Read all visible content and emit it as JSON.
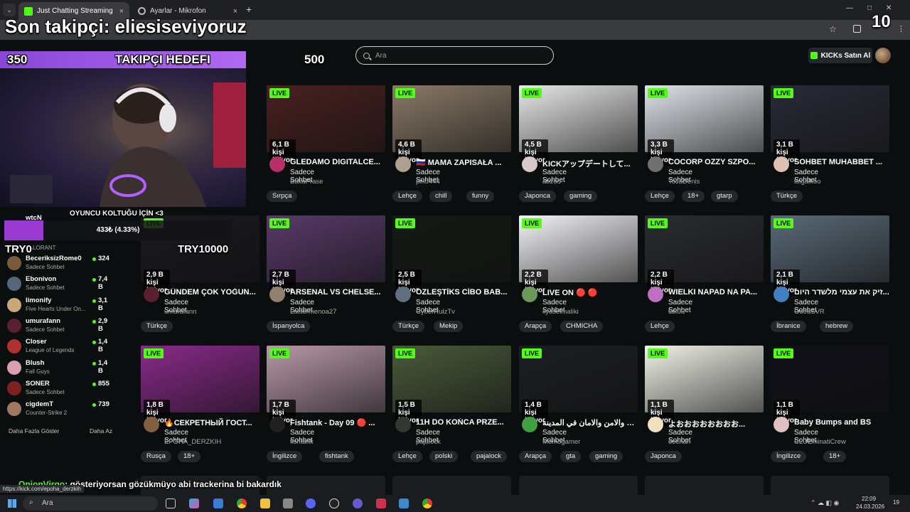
{
  "browser": {
    "tabs": [
      {
        "label": "Just Chatting Streaming - Live S",
        "active": true
      },
      {
        "label": "Ayarlar - Mikrofon",
        "active": false
      }
    ],
    "new_tab": "+",
    "close": "×"
  },
  "site": {
    "search_placeholder": "Ara",
    "kicks_button": "KICKs Satın Al",
    "accent": "#53fc18"
  },
  "overlay": {
    "last_follower": "Son takipçi: eliesiseviyoruz",
    "counter": "10",
    "goal_start": "350",
    "goal_label": "TAKIPÇI HEDEFI",
    "goal_end": "500",
    "chair_goal": "OYUNCU KOLTUĞU İÇİN <3",
    "chair_progress": "433₺ (4.33%)",
    "chair_fraction": 0.0433,
    "try0": "TRY0",
    "try10000": "TRY10000",
    "chat_user": "OnionVirgo",
    "chat_message": ": gösteriyorsan gözükmüyo abi trackerina bi bakardık",
    "peek_user": "wtcN",
    "peek_cat": "VALORANT"
  },
  "sidebar": {
    "channels": [
      {
        "name": "BeceriksizRome0",
        "category": "Sadece Sohbet",
        "count": "324",
        "color": "#7a5a3a"
      },
      {
        "name": "Ebonivon",
        "category": "Sadece Sohbet",
        "count": "7,4 B",
        "color": "#556677"
      },
      {
        "name": "limonify",
        "category": "Five Hearts Under On...",
        "count": "3,1 B",
        "color": "#c8a878"
      },
      {
        "name": "umurafann",
        "category": "Sadece Sohbet",
        "count": "2,9 B",
        "color": "#5a2030"
      },
      {
        "name": "Closer",
        "category": "League of Legends",
        "count": "1,4 B",
        "color": "#b03030"
      },
      {
        "name": "Blush",
        "category": "Fall Guys",
        "count": "1,4 B",
        "color": "#d8a0b0"
      },
      {
        "name": "SONER",
        "category": "Sadece Sohbet",
        "count": "855",
        "color": "#802020"
      },
      {
        "name": "cigdemT",
        "category": "Counter-Strike 2",
        "count": "739",
        "color": "#a07860"
      }
    ],
    "more": "Daha Fazla Göster",
    "less": "Daha Az"
  },
  "streams": [
    {
      "title": "GLEDAMO DIGITALCE...",
      "category": "Sadece Sohbet",
      "user": "BakaPrase",
      "viewers": "6,1 B kişi izliyor",
      "tags": [
        "Sırpça"
      ],
      "thumb": "#4a2020",
      "avatar": "#b8306a"
    },
    {
      "title": "🇷🇺 MAMA ZAPISAŁA ...",
      "category": "Sadece Sohbet",
      "user": "pirlo444",
      "viewers": "4,6 B kişi izliyor",
      "tags": [
        "Lehçe",
        "chill",
        "funny"
      ],
      "thumb": "#8a7a68",
      "avatar": "#b0a090"
    },
    {
      "title": "KICKアップデートして...",
      "category": "Sadece Sohbet",
      "user": "abzou",
      "viewers": "4,5 B kişi izliyor",
      "tags": [
        "Japonca",
        "gaming"
      ],
      "thumb": "#e8e8e8",
      "avatar": "#d8c8c8"
    },
    {
      "title": "COCORP OZZY SZPO...",
      "category": "Sadece Sohbet",
      "user": "ToJaDenis",
      "viewers": "3,3 B kişi izliyor",
      "tags": [
        "Lehçe",
        "18+",
        "gtarp"
      ],
      "thumb": "#dfe4ea",
      "avatar": "#707070"
    },
    {
      "title": "SOHBET MUHABBET ...",
      "category": "Sadece Sohbet",
      "user": "tsigalkoo",
      "viewers": "3,1 B kişi izliyor",
      "tags": [
        "Türkçe"
      ],
      "thumb": "#2a2a38",
      "avatar": "#e0c0b0"
    },
    {
      "title": "GÜNDEM ÇOK YOĞUN...",
      "category": "Sadece Sohbet",
      "user": "umurafann",
      "viewers": "2,9 B kişi izliyor",
      "tags": [
        "Türkçe"
      ],
      "thumb": "#1a1a20",
      "avatar": "#5a2030"
    },
    {
      "title": "ARSENAL VS CHELSE...",
      "category": "Sadece Sohbet",
      "user": "Luisormenoa27",
      "viewers": "2,7 B kişi izliyor",
      "tags": [
        "İspanyolca"
      ],
      "thumb": "#5a3a6a",
      "avatar": "#908070"
    },
    {
      "title": "ÖZLEŞTİKS CİBO BAB...",
      "category": "Sadece Sohbet",
      "user": "CyberRulzTv",
      "viewers": "2,5 B kişi izliyor",
      "tags": [
        "Türkçe",
        "Mekip"
      ],
      "thumb": "#151a15",
      "avatar": "#607080"
    },
    {
      "title": "LIVE ON 🔴 🔴",
      "category": "Sadece Sohbet",
      "user": "ilyaselmaliki",
      "viewers": "2,2 B kişi izliyor",
      "tags": [
        "Arapça",
        "CHMICHA"
      ],
      "thumb": "#f4f4f8",
      "avatar": "#6a9a5a"
    },
    {
      "title": "WIELKI NAPAD NA PA...",
      "category": "Sadece Sohbet",
      "user": "takuu",
      "viewers": "2,2 B kişi izliyor",
      "tags": [
        "Lehçe"
      ],
      "thumb": "#2a2c30",
      "avatar": "#c070c0"
    },
    {
      "title": "זיק את עצמי מלשדר היום...",
      "category": "Sadece Sohbet",
      "user": "OdedSVR",
      "viewers": "2,1 B kişi izliyor",
      "tags": [
        "İbranice",
        "hebrew"
      ],
      "thumb": "#5a6a78",
      "avatar": "#4080c0"
    },
    {
      "title": "🔥СЕКРЕТНЫЙ ГОСТ...",
      "category": "Sadece Sohbet",
      "user": "EPOHA_DERZKIH",
      "viewers": "1,8 B kişi izliyor",
      "tags": [
        "Rusça",
        "18+"
      ],
      "thumb": "#8a2a8a",
      "avatar": "#806040"
    },
    {
      "title": "Fishtank - Day 09 🔴 ...",
      "category": "Sadece Sohbet",
      "user": "fishtank",
      "viewers": "1,7 B kişi izliyor",
      "tags": [
        "İngilizce",
        "fishtank"
      ],
      "thumb": "#b898a8",
      "avatar": "#202020"
    },
    {
      "title": "11H DO KOŃCA PRZE...",
      "category": "Sadece Sohbet",
      "user": "pajalock",
      "viewers": "1,5 B kişi izliyor",
      "tags": [
        "Lehçe",
        "polski",
        "pajalock"
      ],
      "thumb": "#4a5a3a",
      "avatar": "#303830"
    },
    {
      "title": "مومو والامن والامان في المدينة...",
      "category": "Sadece Sohbet",
      "user": "Momogamer",
      "viewers": "1,4 B kişi izliyor",
      "tags": [
        "Arapça",
        "gta",
        "gaming"
      ],
      "thumb": "#1c1e22",
      "avatar": "#40a040"
    },
    {
      "title": "よおおおおおおおお...",
      "category": "Sadece Sohbet",
      "user": "oechan",
      "viewers": "1,1 B kişi izliyor",
      "tags": [
        "Japonca"
      ],
      "thumb": "#f2f2ea",
      "avatar": "#f0e0c0"
    },
    {
      "title": "Baby Bumps and BS",
      "category": "Sadece Sohbet",
      "user": "CLUEminatiCrew",
      "viewers": "1,1 B kişi izliyor",
      "tags": [
        "İngilizce",
        "18+"
      ],
      "thumb": "#101018",
      "avatar": "#e0c0c0"
    }
  ],
  "live_label": "LIVE",
  "status_url": "https://kick.com/epoha_derzkih",
  "taskbar": {
    "search": "Ara",
    "time": "22:09",
    "date": "24.03.2026",
    "notif": "19"
  }
}
